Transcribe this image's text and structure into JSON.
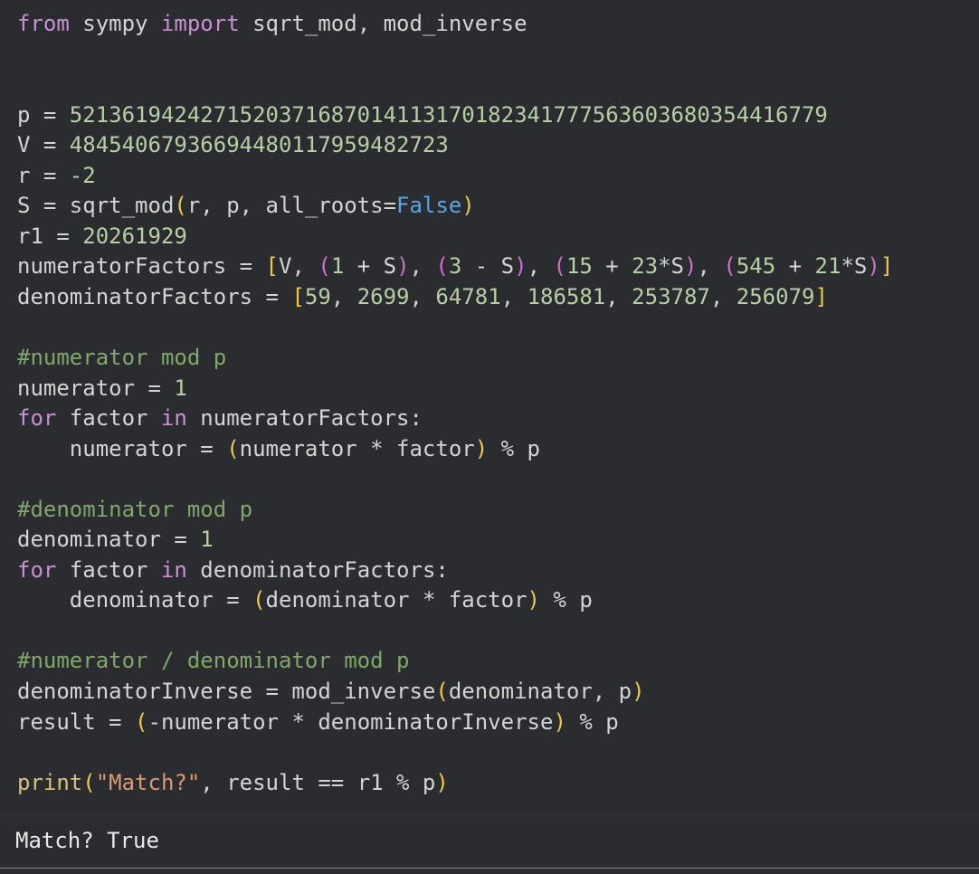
{
  "colors": {
    "background": "#2b2c2f",
    "text": "#d4d4d4",
    "keyword": "#c891d1",
    "builtin": "#d9c27a",
    "number": "#b6d0a4",
    "string": "#d79a77",
    "comment": "#7fa86a",
    "boolean": "#5aa5e2",
    "bracket_outer": "#f2c744",
    "bracket_inner": "#cf6fd3"
  },
  "code_lines": [
    [
      [
        "kw",
        "from"
      ],
      [
        "id",
        " sympy "
      ],
      [
        "kw",
        "import"
      ],
      [
        "id",
        " sqrt_mod, mod_inverse"
      ]
    ],
    [],
    [],
    [
      [
        "id",
        "p = "
      ],
      [
        "num",
        "5213619424271520371687014113170182341777563603680354416779"
      ]
    ],
    [
      [
        "id",
        "V = "
      ],
      [
        "num",
        "48454067936694480117959482723"
      ]
    ],
    [
      [
        "id",
        "r = "
      ],
      [
        "num",
        "-2"
      ]
    ],
    [
      [
        "id",
        "S = sqrt_mod"
      ],
      [
        "b1",
        "("
      ],
      [
        "id",
        "r, p, all_roots="
      ],
      [
        "bool",
        "False"
      ],
      [
        "b1",
        ")"
      ]
    ],
    [
      [
        "id",
        "r1 = "
      ],
      [
        "num",
        "20261929"
      ]
    ],
    [
      [
        "id",
        "numeratorFactors = "
      ],
      [
        "b1",
        "["
      ],
      [
        "id",
        "V, "
      ],
      [
        "b2",
        "("
      ],
      [
        "num",
        "1"
      ],
      [
        "id",
        " + S"
      ],
      [
        "b2",
        ")"
      ],
      [
        "id",
        ", "
      ],
      [
        "b2",
        "("
      ],
      [
        "num",
        "3"
      ],
      [
        "id",
        " - S"
      ],
      [
        "b2",
        ")"
      ],
      [
        "id",
        ", "
      ],
      [
        "b2",
        "("
      ],
      [
        "num",
        "15"
      ],
      [
        "id",
        " + "
      ],
      [
        "num",
        "23"
      ],
      [
        "id",
        "*S"
      ],
      [
        "b2",
        ")"
      ],
      [
        "id",
        ", "
      ],
      [
        "b2",
        "("
      ],
      [
        "num",
        "545"
      ],
      [
        "id",
        " + "
      ],
      [
        "num",
        "21"
      ],
      [
        "id",
        "*S"
      ],
      [
        "b2",
        ")"
      ],
      [
        "b1",
        "]"
      ]
    ],
    [
      [
        "id",
        "denominatorFactors = "
      ],
      [
        "b1",
        "["
      ],
      [
        "num",
        "59"
      ],
      [
        "id",
        ", "
      ],
      [
        "num",
        "2699"
      ],
      [
        "id",
        ", "
      ],
      [
        "num",
        "64781"
      ],
      [
        "id",
        ", "
      ],
      [
        "num",
        "186581"
      ],
      [
        "id",
        ", "
      ],
      [
        "num",
        "253787"
      ],
      [
        "id",
        ", "
      ],
      [
        "num",
        "256079"
      ],
      [
        "b1",
        "]"
      ]
    ],
    [],
    [
      [
        "cmt",
        "#numerator mod p"
      ]
    ],
    [
      [
        "id",
        "numerator = "
      ],
      [
        "num",
        "1"
      ]
    ],
    [
      [
        "kw",
        "for"
      ],
      [
        "id",
        " factor "
      ],
      [
        "kw",
        "in"
      ],
      [
        "id",
        " numeratorFactors:"
      ]
    ],
    [
      [
        "id",
        "    numerator = "
      ],
      [
        "b1",
        "("
      ],
      [
        "id",
        "numerator * factor"
      ],
      [
        "b1",
        ")"
      ],
      [
        "id",
        " % p"
      ]
    ],
    [],
    [
      [
        "cmt",
        "#denominator mod p"
      ]
    ],
    [
      [
        "id",
        "denominator = "
      ],
      [
        "num",
        "1"
      ]
    ],
    [
      [
        "kw",
        "for"
      ],
      [
        "id",
        " factor "
      ],
      [
        "kw",
        "in"
      ],
      [
        "id",
        " denominatorFactors:"
      ]
    ],
    [
      [
        "id",
        "    denominator = "
      ],
      [
        "b1",
        "("
      ],
      [
        "id",
        "denominator * factor"
      ],
      [
        "b1",
        ")"
      ],
      [
        "id",
        " % p"
      ]
    ],
    [],
    [
      [
        "cmt",
        "#numerator / denominator mod p"
      ]
    ],
    [
      [
        "id",
        "denominatorInverse = mod_inverse"
      ],
      [
        "b1",
        "("
      ],
      [
        "id",
        "denominator, p"
      ],
      [
        "b1",
        ")"
      ]
    ],
    [
      [
        "id",
        "result = "
      ],
      [
        "b1",
        "("
      ],
      [
        "id",
        "-numerator * denominatorInverse"
      ],
      [
        "b1",
        ")"
      ],
      [
        "id",
        " % p"
      ]
    ],
    [],
    [
      [
        "bi",
        "print"
      ],
      [
        "b1",
        "("
      ],
      [
        "str",
        "\"Match?\""
      ],
      [
        "id",
        ", result == r1 % p"
      ],
      [
        "b1",
        ")"
      ]
    ]
  ],
  "output": {
    "text": "Match? True"
  }
}
